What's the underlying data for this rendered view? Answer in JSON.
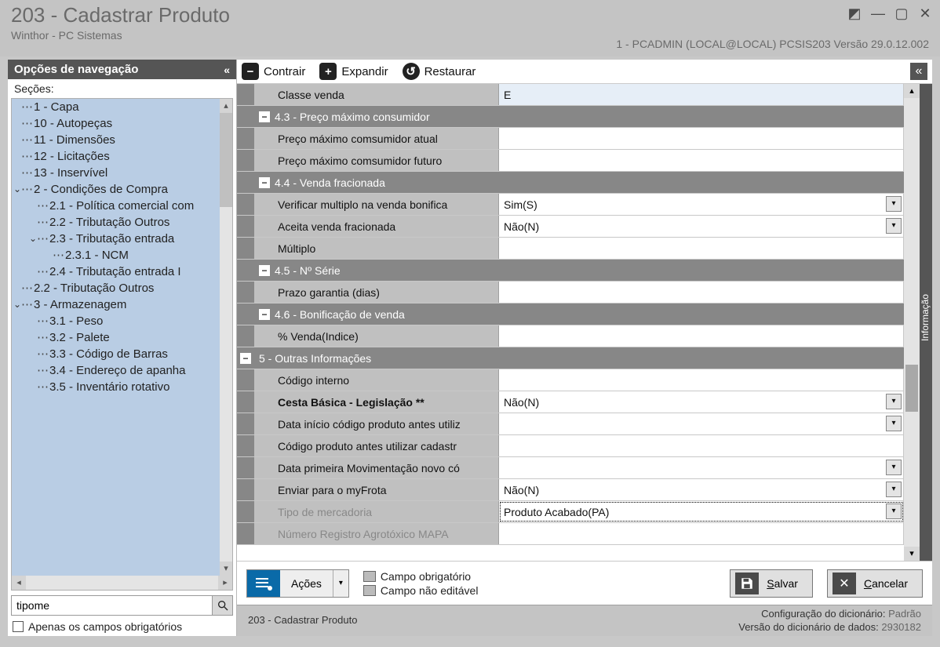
{
  "window": {
    "title": "203 - Cadastrar  Produto",
    "subtitle": "Winthor - PC Sistemas",
    "info_right": "1 - PCADMIN (LOCAL@LOCAL)   PCSIS203  Versão  29.0.12.002"
  },
  "sidebar": {
    "header": "Opções de navegação",
    "sections_label": "Seções:",
    "tree": [
      {
        "t": "1 - Capa",
        "lvl": 0,
        "exp": ""
      },
      {
        "t": "10 - Autopeças",
        "lvl": 0,
        "exp": ""
      },
      {
        "t": "11 - Dimensões",
        "lvl": 0,
        "exp": ""
      },
      {
        "t": "12 - Licitações",
        "lvl": 0,
        "exp": ""
      },
      {
        "t": "13 - Inservível",
        "lvl": 0,
        "exp": ""
      },
      {
        "t": "2 - Condições de Compra",
        "lvl": 0,
        "exp": "v"
      },
      {
        "t": "2.1 - Política comercial com",
        "lvl": 1,
        "exp": ""
      },
      {
        "t": "2.2 - Tributação Outros",
        "lvl": 1,
        "exp": ""
      },
      {
        "t": "2.3 - Tributação entrada",
        "lvl": 1,
        "exp": "v"
      },
      {
        "t": "2.3.1 - NCM",
        "lvl": 2,
        "exp": ""
      },
      {
        "t": "2.4 - Tributação entrada I",
        "lvl": 1,
        "exp": ""
      },
      {
        "t": "2.2 - Tributação Outros",
        "lvl": 0,
        "exp": ""
      },
      {
        "t": "3 - Armazenagem",
        "lvl": 0,
        "exp": "v"
      },
      {
        "t": "3.1 - Peso",
        "lvl": 1,
        "exp": ""
      },
      {
        "t": "3.2 - Palete",
        "lvl": 1,
        "exp": ""
      },
      {
        "t": "3.3 - Código de Barras",
        "lvl": 1,
        "exp": ""
      },
      {
        "t": "3.4 - Endereço de apanha",
        "lvl": 1,
        "exp": ""
      },
      {
        "t": "3.5 - Inventário rotativo",
        "lvl": 1,
        "exp": ""
      }
    ],
    "search_value": "tipome",
    "mandatory_label": "Apenas os campos obrigatórios"
  },
  "toolbar": {
    "contrair": "Contrair",
    "expandir": "Expandir",
    "restaurar": "Restaurar"
  },
  "grid": [
    {
      "kind": "row",
      "first": true,
      "label": "Classe venda",
      "val": "E"
    },
    {
      "kind": "section",
      "label": "4.3 - Preço máximo consumidor"
    },
    {
      "kind": "row",
      "label": "Preço máximo comsumidor atual",
      "val": ""
    },
    {
      "kind": "row",
      "label": "Preço máximo comsumidor futuro",
      "val": ""
    },
    {
      "kind": "section",
      "label": "4.4 - Venda fracionada"
    },
    {
      "kind": "row",
      "label": "Verificar multiplo na venda bonifica",
      "val": "Sim(S)",
      "dd": true
    },
    {
      "kind": "row",
      "label": "Aceita venda fracionada",
      "val": "Não(N)",
      "dd": true
    },
    {
      "kind": "row",
      "label": "Múltiplo",
      "val": ""
    },
    {
      "kind": "section",
      "label": "4.5 - Nº Série"
    },
    {
      "kind": "row",
      "label": "Prazo garantia (dias)",
      "val": ""
    },
    {
      "kind": "section",
      "label": "4.6 - Bonificação de venda"
    },
    {
      "kind": "row",
      "label": "% Venda(Indice)",
      "val": ""
    },
    {
      "kind": "section",
      "top": true,
      "label": "5 - Outras Informações"
    },
    {
      "kind": "row",
      "label": "Código interno",
      "val": ""
    },
    {
      "kind": "row",
      "bold": true,
      "label": "Cesta Básica - Legislação **",
      "val": "Não(N)",
      "dd": true
    },
    {
      "kind": "row",
      "label": "Data início código produto antes utiliz",
      "val": "",
      "dd": true
    },
    {
      "kind": "row",
      "label": "Código produto antes utilizar cadastr",
      "val": ""
    },
    {
      "kind": "row",
      "label": "Data primeira Movimentação novo có",
      "val": "",
      "dd": true
    },
    {
      "kind": "row",
      "label": "Enviar para o myFrota",
      "val": "Não(N)",
      "dd": true
    },
    {
      "kind": "row",
      "highlight": true,
      "label": "Tipo de mercadoria",
      "val": "Produto Acabado(PA)",
      "dd": true
    },
    {
      "kind": "row",
      "cut": true,
      "label": "Número Registro Agrotóxico MAPA",
      "val": ""
    }
  ],
  "info_tab": "Informação",
  "bottom": {
    "acoes": "Ações",
    "legend_mandatory": "Campo obrigatório",
    "legend_readonly": "Campo não editável",
    "salvar": "Salvar",
    "salvar_u": "S",
    "cancelar": "Cancelar",
    "cancelar_u": "C"
  },
  "status": {
    "left": "203 - Cadastrar  Produto",
    "cfg_label": "Configuração do dicionário:",
    "cfg_val": "Padrão",
    "ver_label": "Versão do dicionário de dados:",
    "ver_val": "2930182"
  }
}
